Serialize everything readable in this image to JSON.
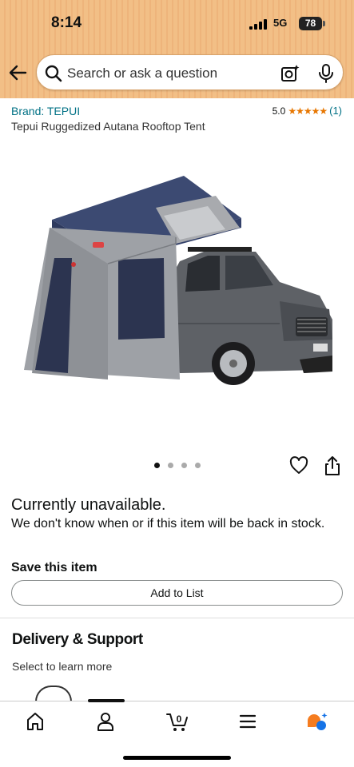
{
  "status_bar": {
    "time": "8:14",
    "network": "5G",
    "battery": "78"
  },
  "search": {
    "placeholder": "Search or ask a question"
  },
  "product": {
    "brand": "Brand: TEPUI",
    "rating_value": "5.0",
    "stars": "★★★★★",
    "rating_count": "(1)",
    "title": "Tepui Ruggedized Autana Rooftop Tent"
  },
  "gallery": {
    "image_count": 4,
    "active_index": 0
  },
  "availability": {
    "heading": "Currently unavailable.",
    "note": "We don't know when or if this item will be back in stock."
  },
  "save": {
    "heading": "Save this item",
    "button_label": "Add to List"
  },
  "delivery": {
    "heading": "Delivery & Support",
    "subtext": "Select to learn more"
  },
  "bottom_nav": {
    "items": [
      "home-icon",
      "account-icon",
      "cart-icon",
      "menu-icon",
      "rufus-icon"
    ],
    "cart_count": "0"
  },
  "colors": {
    "header_bg": "#f2bf86",
    "link": "#007185",
    "stars": "#e77600"
  }
}
